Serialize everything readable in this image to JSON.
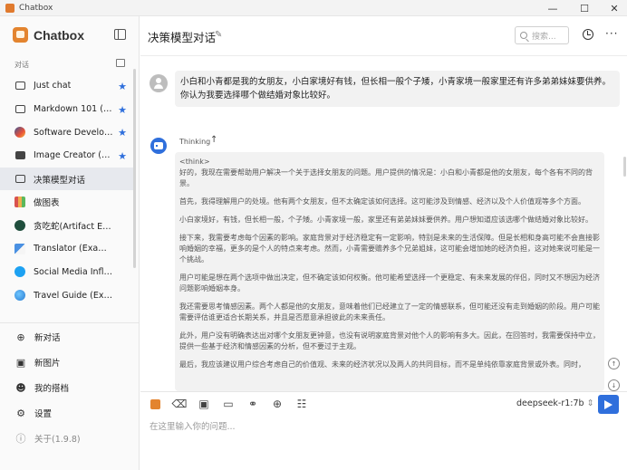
{
  "window": {
    "title": "Chatbox",
    "controls": [
      "—",
      "☐",
      "✕"
    ]
  },
  "sidebar": {
    "brand": "Chatbox",
    "section_label": "对话",
    "conversations": [
      {
        "label": "Just chat",
        "icon": "chat-bubble-icon",
        "starred": true,
        "active": false
      },
      {
        "label": "Markdown 101 (E...",
        "icon": "chat-bubble-icon",
        "starred": true,
        "active": false
      },
      {
        "label": "Software Develop...",
        "icon": "developer-avatar-icon",
        "starred": true,
        "active": false
      },
      {
        "label": "Image Creator (E...",
        "icon": "image-creator-icon",
        "starred": true,
        "active": false
      },
      {
        "label": "决策模型对话",
        "icon": "chat-bubble-icon",
        "starred": false,
        "active": true
      },
      {
        "label": "做图表",
        "icon": "chart-avatar-icon",
        "starred": false,
        "active": false
      },
      {
        "label": "贪吃蛇(Artifact Example)",
        "icon": "snake-avatar-icon",
        "starred": false,
        "active": false
      },
      {
        "label": "Translator (Example)",
        "icon": "translator-avatar-icon",
        "starred": false,
        "active": false
      },
      {
        "label": "Social Media Influence...",
        "icon": "twitter-avatar-icon",
        "starred": false,
        "active": false
      },
      {
        "label": "Travel Guide (Example)",
        "icon": "globe-avatar-icon",
        "starred": false,
        "active": false
      }
    ],
    "actions": {
      "new_chat": "新对话",
      "new_image": "新图片",
      "my_partner": "我的搭档",
      "settings": "设置",
      "about": "关于(1.9.8)"
    }
  },
  "header": {
    "title": "决策模型对话",
    "search_placeholder": "搜索..."
  },
  "messages": {
    "user": "小白和小青都是我的女朋友，小白家境好有钱，但长相一般个子矮，小青家境一般家里还有许多弟弟妹妹要供养。你认为我要选择哪个做结婚对象比较好。",
    "thinking_label": "Thinking",
    "think_tag": "<think>",
    "paragraphs": [
      "好的，我现在需要帮助用户解决一个关于选择女朋友的问题。用户提供的情况是：小白和小青都是他的女朋友，每个各有不同的背景。",
      "首先，我得理解用户的处境。他有两个女朋友，但不太确定该如何选择。这可能涉及到情感、经济以及个人价值观等多个方面。",
      "小白家境好，有钱，但长相一般，个子矮。小青家境一般，家里还有弟弟妹妹要供养。用户想知道应该选哪个做结婚对象比较好。",
      "接下来，我需要考虑每个因素的影响。家庭背景对于经济稳定有一定影响，特别是未来的生活保障。但是长相和身高可能不会直接影响婚姻的幸福，更多的是个人的特点来考虑。然而，小青需要赡养多个兄弟姐妹，这可能会增加她的经济负担，这对她来说可能是一个挑战。",
      "用户可能是想在两个选项中做出决定，但不确定该如何权衡。他可能希望选择一个更稳定、有未来发展的伴侣，同时又不想因为经济问题影响婚姻本身。",
      "我还需要思考情感因素。两个人都是他的女朋友，意味着他们已经建立了一定的情感联系，但可能还没有走到婚姻的阶段。用户可能需要评估谁更适合长期关系，并且是否愿意承担彼此的未来责任。",
      "此外，用户没有明确表达出对哪个女朋友更钟意，也没有说明家庭背景对他个人的影响有多大。因此，在回答时，我需要保持中立，提供一些基于经济和情感因素的分析，但不要过于主观。",
      "最后，我应该建议用户综合考虑自己的价值观、未来的经济状况以及两人的共同目标，而不是单纯依靠家庭背景或外表。同时，"
    ]
  },
  "composer": {
    "model": "deepseek-r1:7b",
    "input_placeholder": "在这里输入你的问题..."
  },
  "colors": {
    "accent": "#2f6fdc",
    "brand": "#e3842f"
  }
}
